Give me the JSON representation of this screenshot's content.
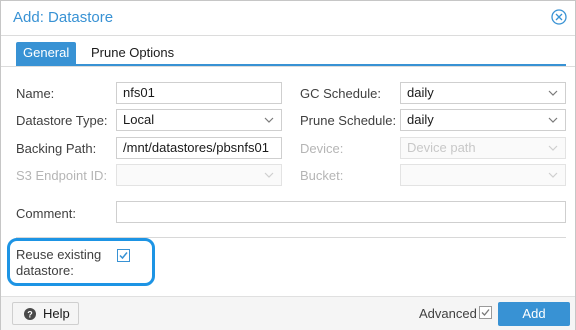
{
  "dialog": {
    "title": "Add: Datastore"
  },
  "tabs": [
    {
      "label": "General",
      "active": true
    },
    {
      "label": "Prune Options",
      "active": false
    }
  ],
  "form": {
    "name": {
      "label": "Name:",
      "value": "nfs01"
    },
    "datastore_type": {
      "label": "Datastore Type:",
      "value": "Local"
    },
    "backing_path": {
      "label": "Backing Path:",
      "value": "/mnt/datastores/pbsnfs01"
    },
    "s3_endpoint": {
      "label": "S3 Endpoint ID:",
      "value": ""
    },
    "gc_schedule": {
      "label": "GC Schedule:",
      "value": "daily"
    },
    "prune_schedule": {
      "label": "Prune Schedule:",
      "value": "daily"
    },
    "device": {
      "label": "Device:",
      "placeholder": "Device path"
    },
    "bucket": {
      "label": "Bucket:",
      "value": ""
    },
    "comment": {
      "label": "Comment:",
      "value": ""
    },
    "reuse": {
      "label_line1": "Reuse existing",
      "label_line2": "datastore:",
      "checked": true
    }
  },
  "footer": {
    "help_label": "Help",
    "advanced_label": "Advanced",
    "advanced_checked": true,
    "add_label": "Add"
  },
  "colors": {
    "accent": "#3892d4",
    "highlight": "#1d94e4"
  },
  "icons": [
    "close-icon",
    "chevron-down-icon",
    "help-icon",
    "checkmark-icon"
  ]
}
